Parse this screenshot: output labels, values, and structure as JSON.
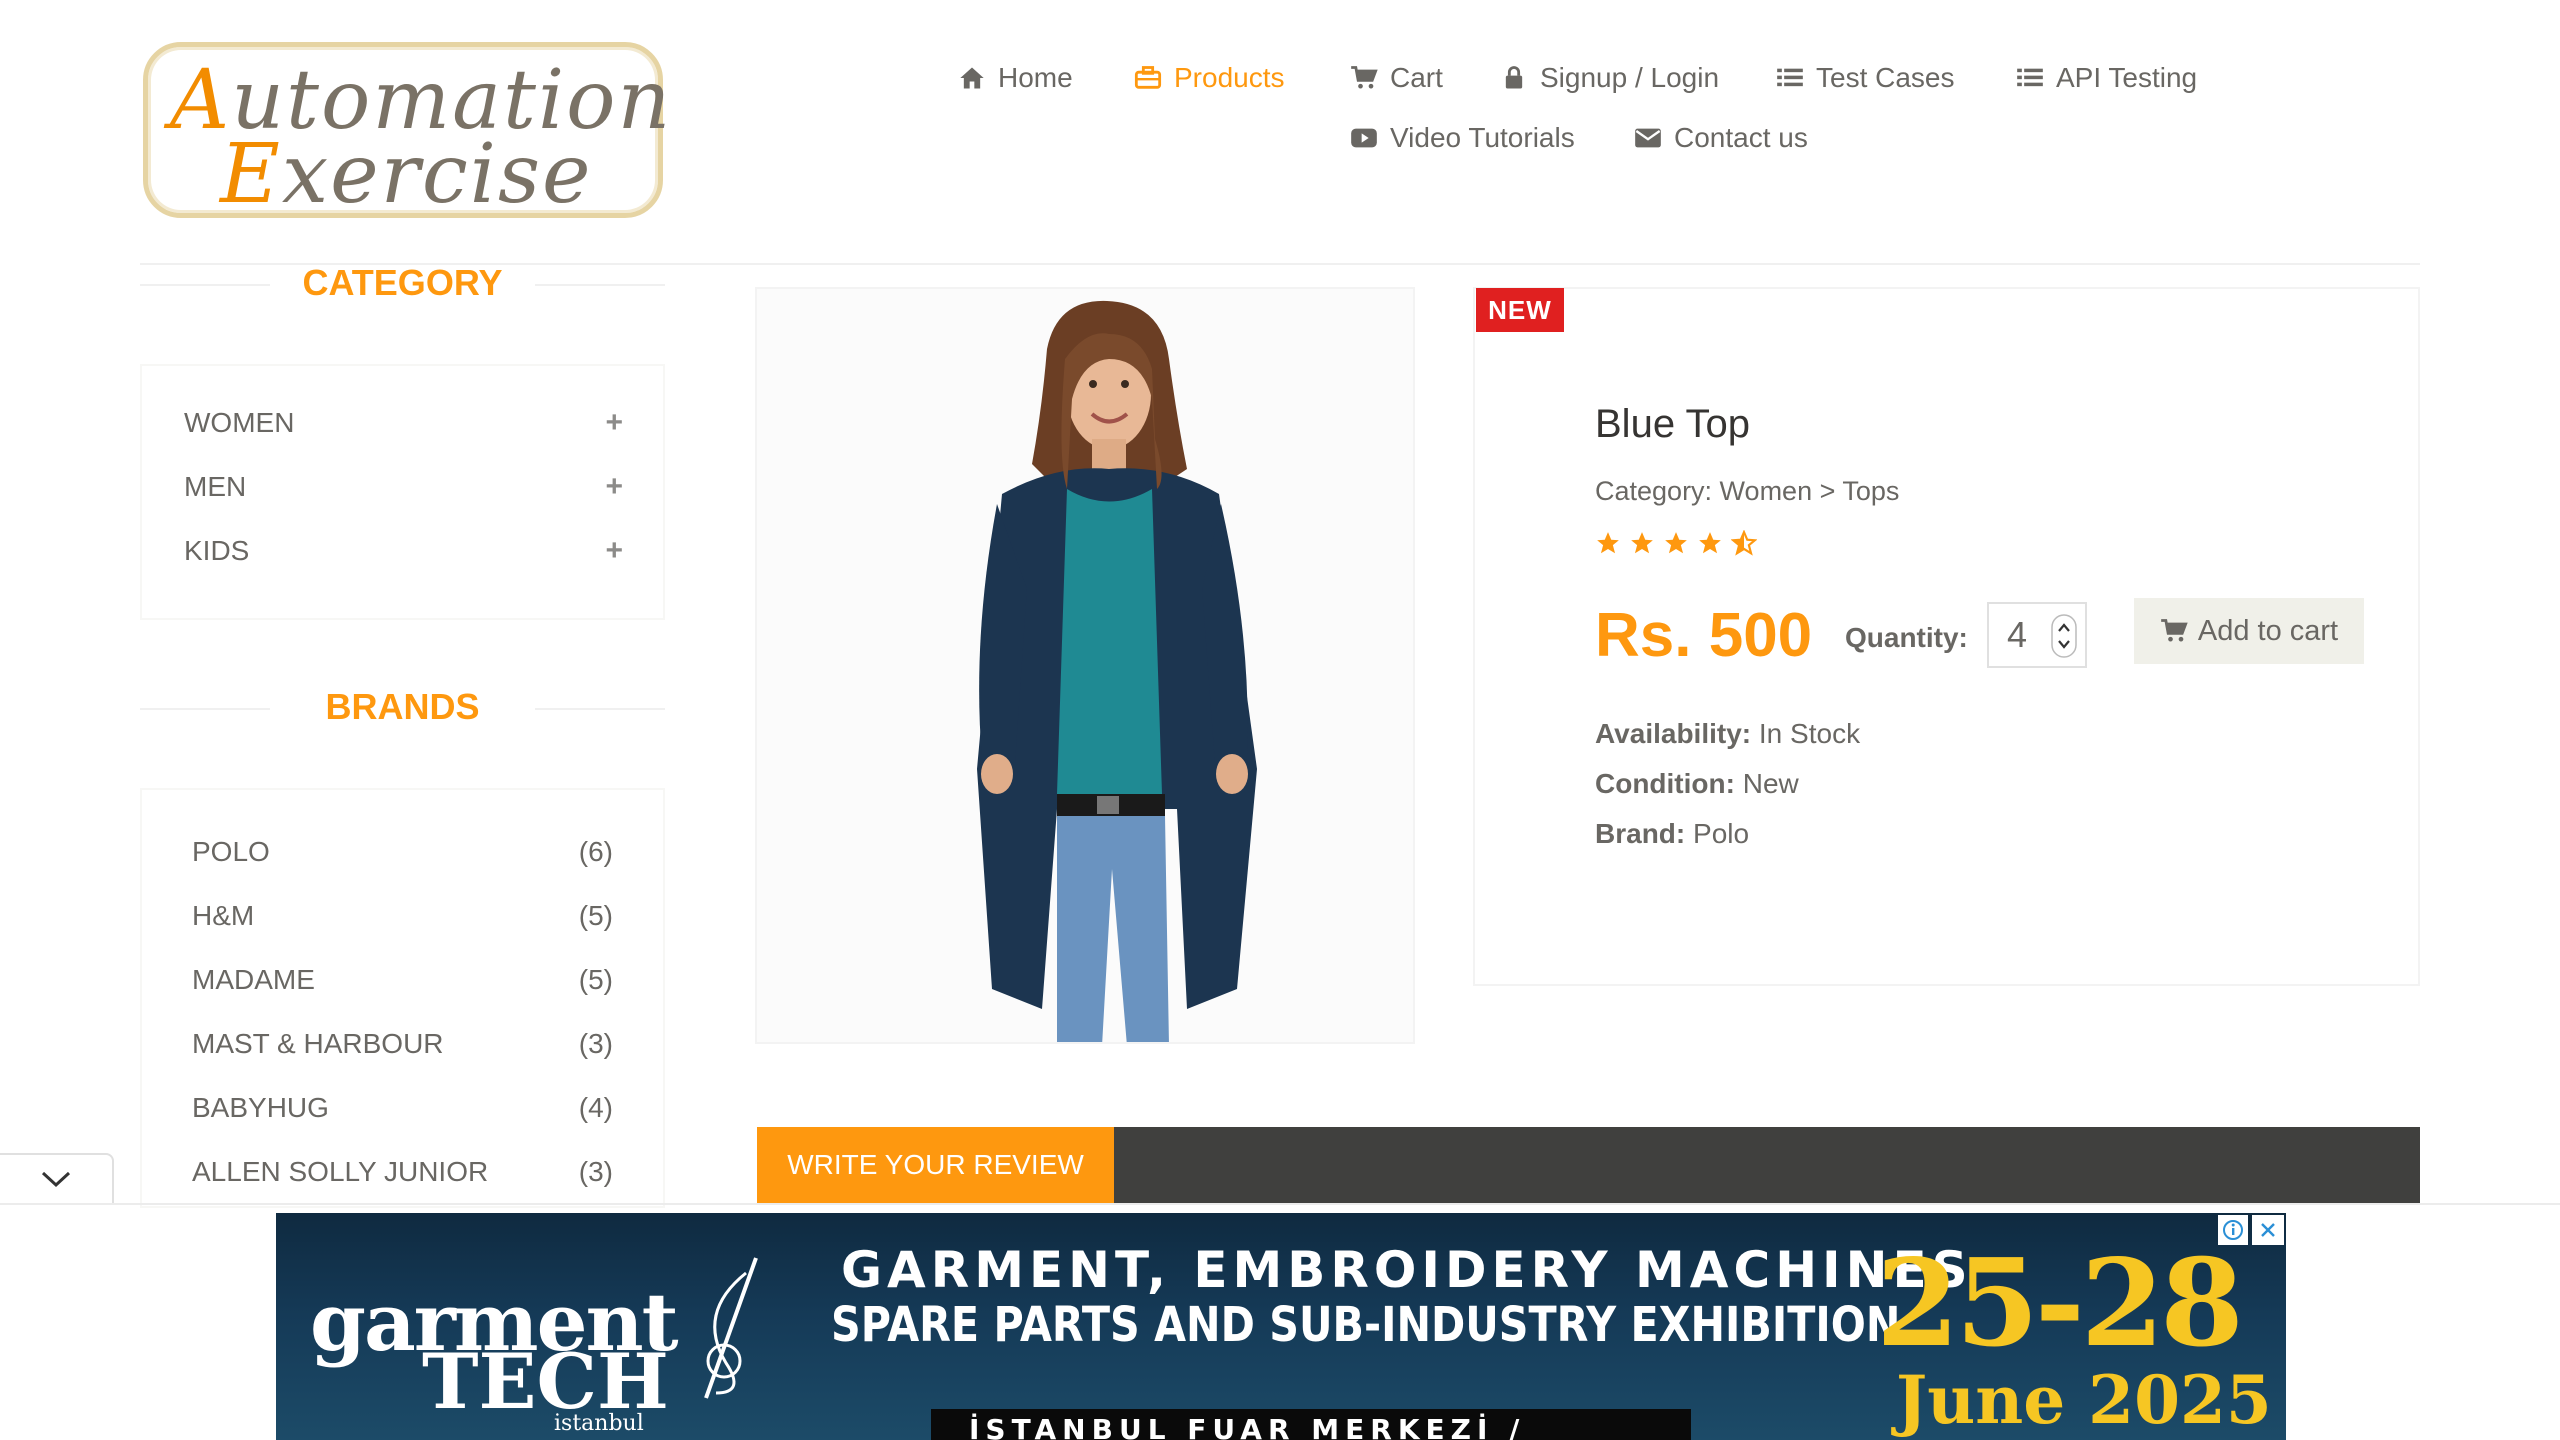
{
  "logo": {
    "line1": "Automation",
    "line2": "Exercise"
  },
  "nav": {
    "row1": [
      {
        "label": "Home",
        "icon": "home-icon"
      },
      {
        "label": "Products",
        "icon": "briefcase-icon",
        "active": true
      },
      {
        "label": "Cart",
        "icon": "cart-icon"
      },
      {
        "label": "Signup / Login",
        "icon": "lock-icon"
      },
      {
        "label": "Test Cases",
        "icon": "list-icon"
      },
      {
        "label": "API Testing",
        "icon": "list-icon"
      }
    ],
    "row2": [
      {
        "label": "Video Tutorials",
        "icon": "youtube-icon"
      },
      {
        "label": "Contact us",
        "icon": "envelope-icon"
      }
    ]
  },
  "sidebar": {
    "category_title": "CATEGORY",
    "categories": [
      {
        "label": "WOMEN"
      },
      {
        "label": "MEN"
      },
      {
        "label": "KIDS"
      }
    ],
    "brands_title": "BRANDS",
    "brands": [
      {
        "name": "POLO",
        "count": "(6)"
      },
      {
        "name": "H&M",
        "count": "(5)"
      },
      {
        "name": "MADAME",
        "count": "(5)"
      },
      {
        "name": "MAST & HARBOUR",
        "count": "(3)"
      },
      {
        "name": "BABYHUG",
        "count": "(4)"
      },
      {
        "name": "ALLEN SOLLY JUNIOR",
        "count": "(3)"
      }
    ]
  },
  "product": {
    "badge": "NEW",
    "title": "Blue Top",
    "category": "Category: Women > Tops",
    "rating": 4.5,
    "price": "Rs. 500",
    "quantity_label": "Quantity:",
    "quantity": "4",
    "add_to_cart": "Add to cart",
    "availability_label": "Availability:",
    "availability": "In Stock",
    "condition_label": "Condition:",
    "condition": "New",
    "brand_label": "Brand:",
    "brand": "Polo"
  },
  "review": {
    "tab_label": "WRITE YOUR REVIEW"
  },
  "ad": {
    "brand_line1": "garment",
    "brand_line2": "TECH",
    "brand_line3": "istanbul",
    "headline1": "GARMENT, EMBROIDERY MACHINES",
    "headline2": "SPARE PARTS AND SUB-INDUSTRY EXHIBITION",
    "venue": "İSTANBUL FUAR MERKEZİ / YEŞİLKÖY",
    "dates": "25-28",
    "month": "June 2025"
  },
  "colors": {
    "accent": "#fe980f",
    "text": "#696763",
    "badge": "#e02020",
    "dark_bar": "#40403e"
  }
}
